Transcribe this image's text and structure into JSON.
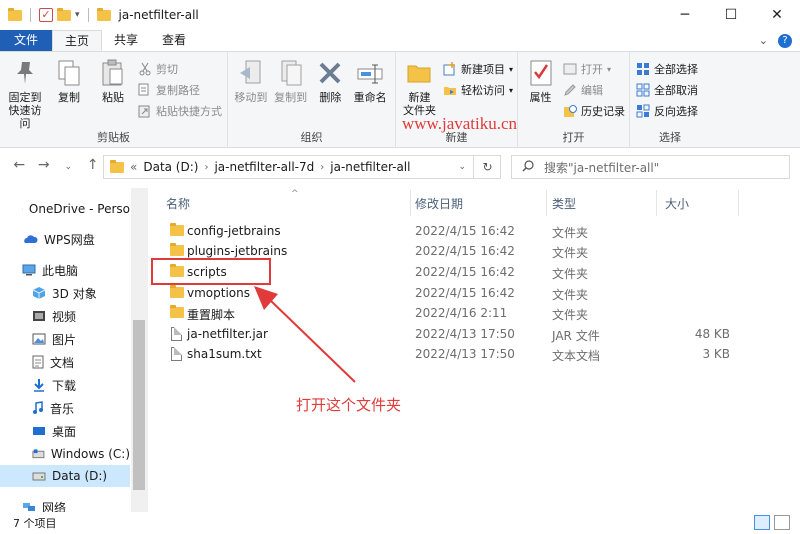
{
  "window": {
    "title": "ja-netfilter-all",
    "minimize": "─",
    "maximize": "☐",
    "close": "✕"
  },
  "tabs": [
    {
      "label": "文件"
    },
    {
      "label": "主页"
    },
    {
      "label": "共享"
    },
    {
      "label": "查看"
    }
  ],
  "ribbon": {
    "clipboard": {
      "label": "剪贴板",
      "pin": "固定到\n快速访问",
      "copy": "复制",
      "paste": "粘贴",
      "cut": "剪切",
      "copy_path": "复制路径",
      "paste_shortcut": "粘贴快捷方式"
    },
    "organize": {
      "label": "组织",
      "move_to": "移动到",
      "copy_to": "复制到",
      "delete": "删除",
      "rename": "重命名"
    },
    "new": {
      "label": "新建",
      "new_folder": "新建\n文件夹",
      "new_item": "新建项目",
      "easy_access": "轻松访问"
    },
    "open": {
      "label": "打开",
      "properties": "属性",
      "open": "打开",
      "edit": "编辑",
      "history": "历史记录"
    },
    "select": {
      "label": "选择",
      "select_all": "全部选择",
      "select_none": "全部取消",
      "invert": "反向选择"
    }
  },
  "watermark": "www.javatiku.cn",
  "address": {
    "overflow": "«",
    "crumbs": [
      "Data (D:)",
      "ja-netfilter-all-7d",
      "ja-netfilter-all"
    ],
    "search_placeholder": "搜索\"ja-netfilter-all\""
  },
  "sidebar": {
    "items": [
      {
        "label": "OneDrive - Perso"
      },
      {
        "label": "WPS网盘"
      },
      {
        "label": "此电脑"
      },
      {
        "label": "3D 对象"
      },
      {
        "label": "视频"
      },
      {
        "label": "图片"
      },
      {
        "label": "文档"
      },
      {
        "label": "下载"
      },
      {
        "label": "音乐"
      },
      {
        "label": "桌面"
      },
      {
        "label": "Windows (C:)"
      },
      {
        "label": "Data (D:)"
      },
      {
        "label": "网络"
      }
    ]
  },
  "columns": {
    "name": "名称",
    "date": "修改日期",
    "type": "类型",
    "size": "大小"
  },
  "files": [
    {
      "name": "config-jetbrains",
      "date": "2022/4/15 16:42",
      "type": "文件夹",
      "size": "",
      "kind": "folder"
    },
    {
      "name": "plugins-jetbrains",
      "date": "2022/4/15 16:42",
      "type": "文件夹",
      "size": "",
      "kind": "folder"
    },
    {
      "name": "scripts",
      "date": "2022/4/15 16:42",
      "type": "文件夹",
      "size": "",
      "kind": "folder"
    },
    {
      "name": "vmoptions",
      "date": "2022/4/15 16:42",
      "type": "文件夹",
      "size": "",
      "kind": "folder"
    },
    {
      "name": "重置脚本",
      "date": "2022/4/16 2:11",
      "type": "文件夹",
      "size": "",
      "kind": "folder"
    },
    {
      "name": "ja-netfilter.jar",
      "date": "2022/4/13 17:50",
      "type": "JAR 文件",
      "size": "48 KB",
      "kind": "file"
    },
    {
      "name": "sha1sum.txt",
      "date": "2022/4/13 17:50",
      "type": "文本文档",
      "size": "3 KB",
      "kind": "file"
    }
  ],
  "annotation": "打开这个文件夹",
  "status": {
    "count": "7 个项目"
  },
  "colors": {
    "accent": "#1f5fb6",
    "annotation": "#e03a3a",
    "folder": "#f3c247",
    "selected": "#cce8ff"
  }
}
